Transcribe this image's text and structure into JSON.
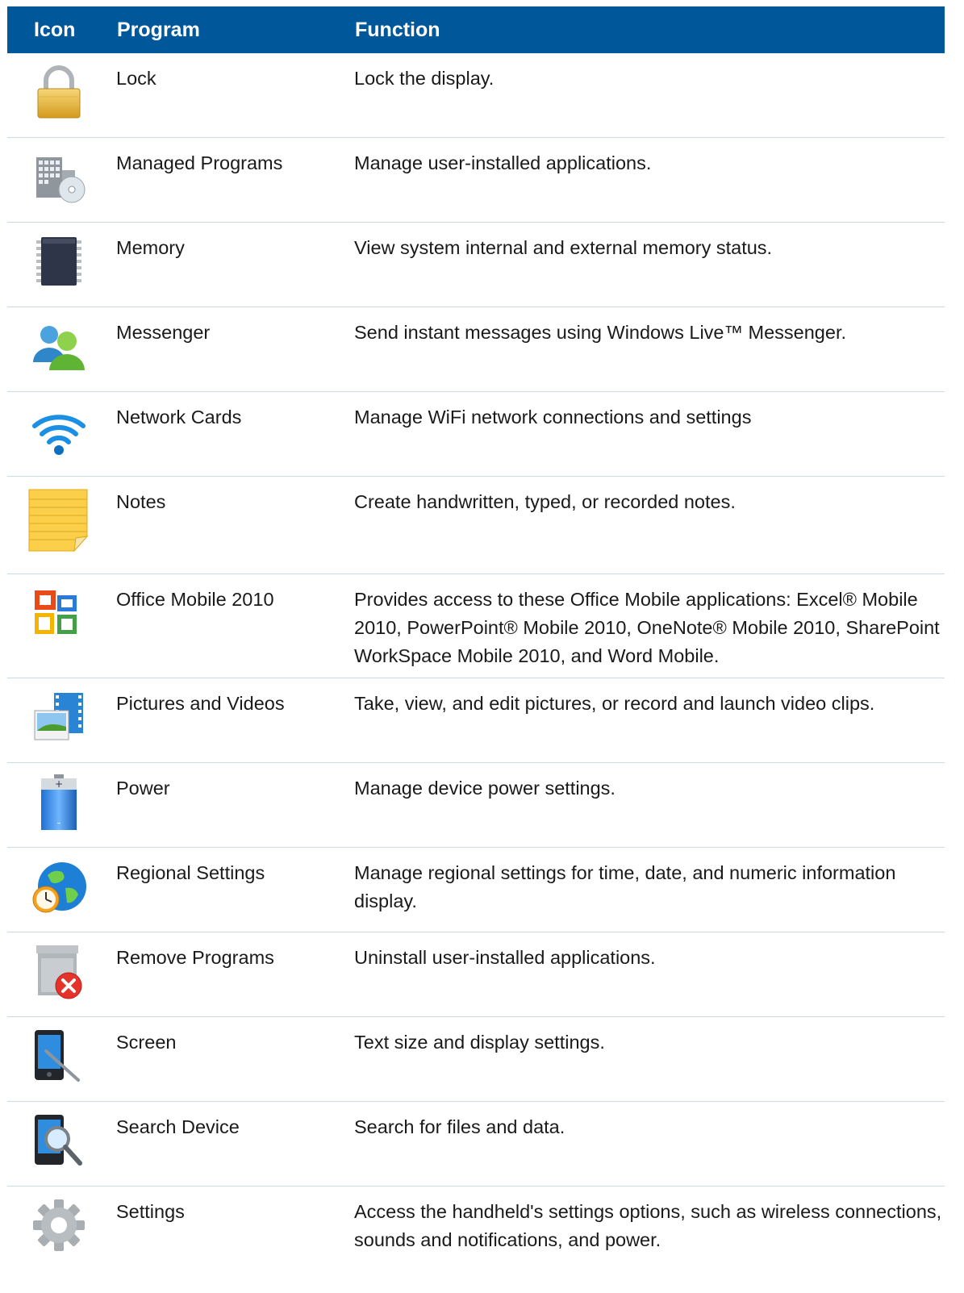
{
  "header": {
    "icon": "Icon",
    "program": "Program",
    "function": "Function"
  },
  "rows": [
    {
      "icon": "lock-icon",
      "program": "Lock",
      "function": "Lock the display."
    },
    {
      "icon": "managed-programs-icon",
      "program": "Managed Programs",
      "function": "Manage user-installed applications."
    },
    {
      "icon": "memory-chip-icon",
      "program": "Memory",
      "function": "View system internal and external memory status."
    },
    {
      "icon": "messenger-icon",
      "program": "Messenger",
      "function": "Send instant messages using Windows Live™ Messenger."
    },
    {
      "icon": "wifi-icon",
      "program": "Network Cards",
      "function": "Manage WiFi network connections and settings"
    },
    {
      "icon": "notes-icon",
      "program": "Notes",
      "function": "Create handwritten, typed, or recorded notes."
    },
    {
      "icon": "office-icon",
      "program": "Office Mobile 2010",
      "function": "Provides access to these Office Mobile applications: Excel® Mobile 2010, PowerPoint® Mobile 2010, OneNote® Mobile 2010, SharePoint WorkSpace Mobile 2010, and Word Mobile."
    },
    {
      "icon": "pictures-videos-icon",
      "program": "Pictures and Videos",
      "function": "Take, view, and edit pictures, or record and launch video clips."
    },
    {
      "icon": "battery-icon",
      "program": "Power",
      "function": "Manage device power settings."
    },
    {
      "icon": "globe-clock-icon",
      "program": "Regional Settings",
      "function": "Manage regional settings for time, date, and numeric information display."
    },
    {
      "icon": "remove-programs-icon",
      "program": "Remove Programs",
      "function": "Uninstall user-installed applications."
    },
    {
      "icon": "screen-stylus-icon",
      "program": "Screen",
      "function": "Text size and display settings."
    },
    {
      "icon": "search-device-icon",
      "program": "Search Device",
      "function": "Search for files and data."
    },
    {
      "icon": "gear-icon",
      "program": "Settings",
      "function": "Access the handheld's settings options, such as wireless connections, sounds and notifications, and power."
    }
  ]
}
